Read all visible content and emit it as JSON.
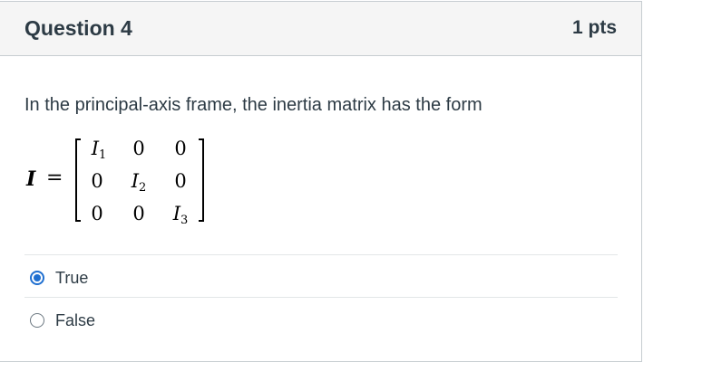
{
  "question": {
    "title": "Question 4",
    "points": "1 pts",
    "text": "In the principal-axis frame, the inertia matrix has the form"
  },
  "equation": {
    "variable": "I",
    "equals": "=",
    "matrix": [
      [
        "I",
        "0",
        "0"
      ],
      [
        "0",
        "I",
        "0"
      ],
      [
        "0",
        "0",
        "I"
      ]
    ],
    "subscripts": [
      "1",
      "2",
      "3"
    ]
  },
  "answers": {
    "options": [
      {
        "label": "True",
        "selected": true
      },
      {
        "label": "False",
        "selected": false
      }
    ]
  },
  "colors": {
    "accent": "#1f6fd0",
    "header_bg": "#f5f5f5",
    "border": "#c7cdd1",
    "text": "#2d3b45"
  }
}
